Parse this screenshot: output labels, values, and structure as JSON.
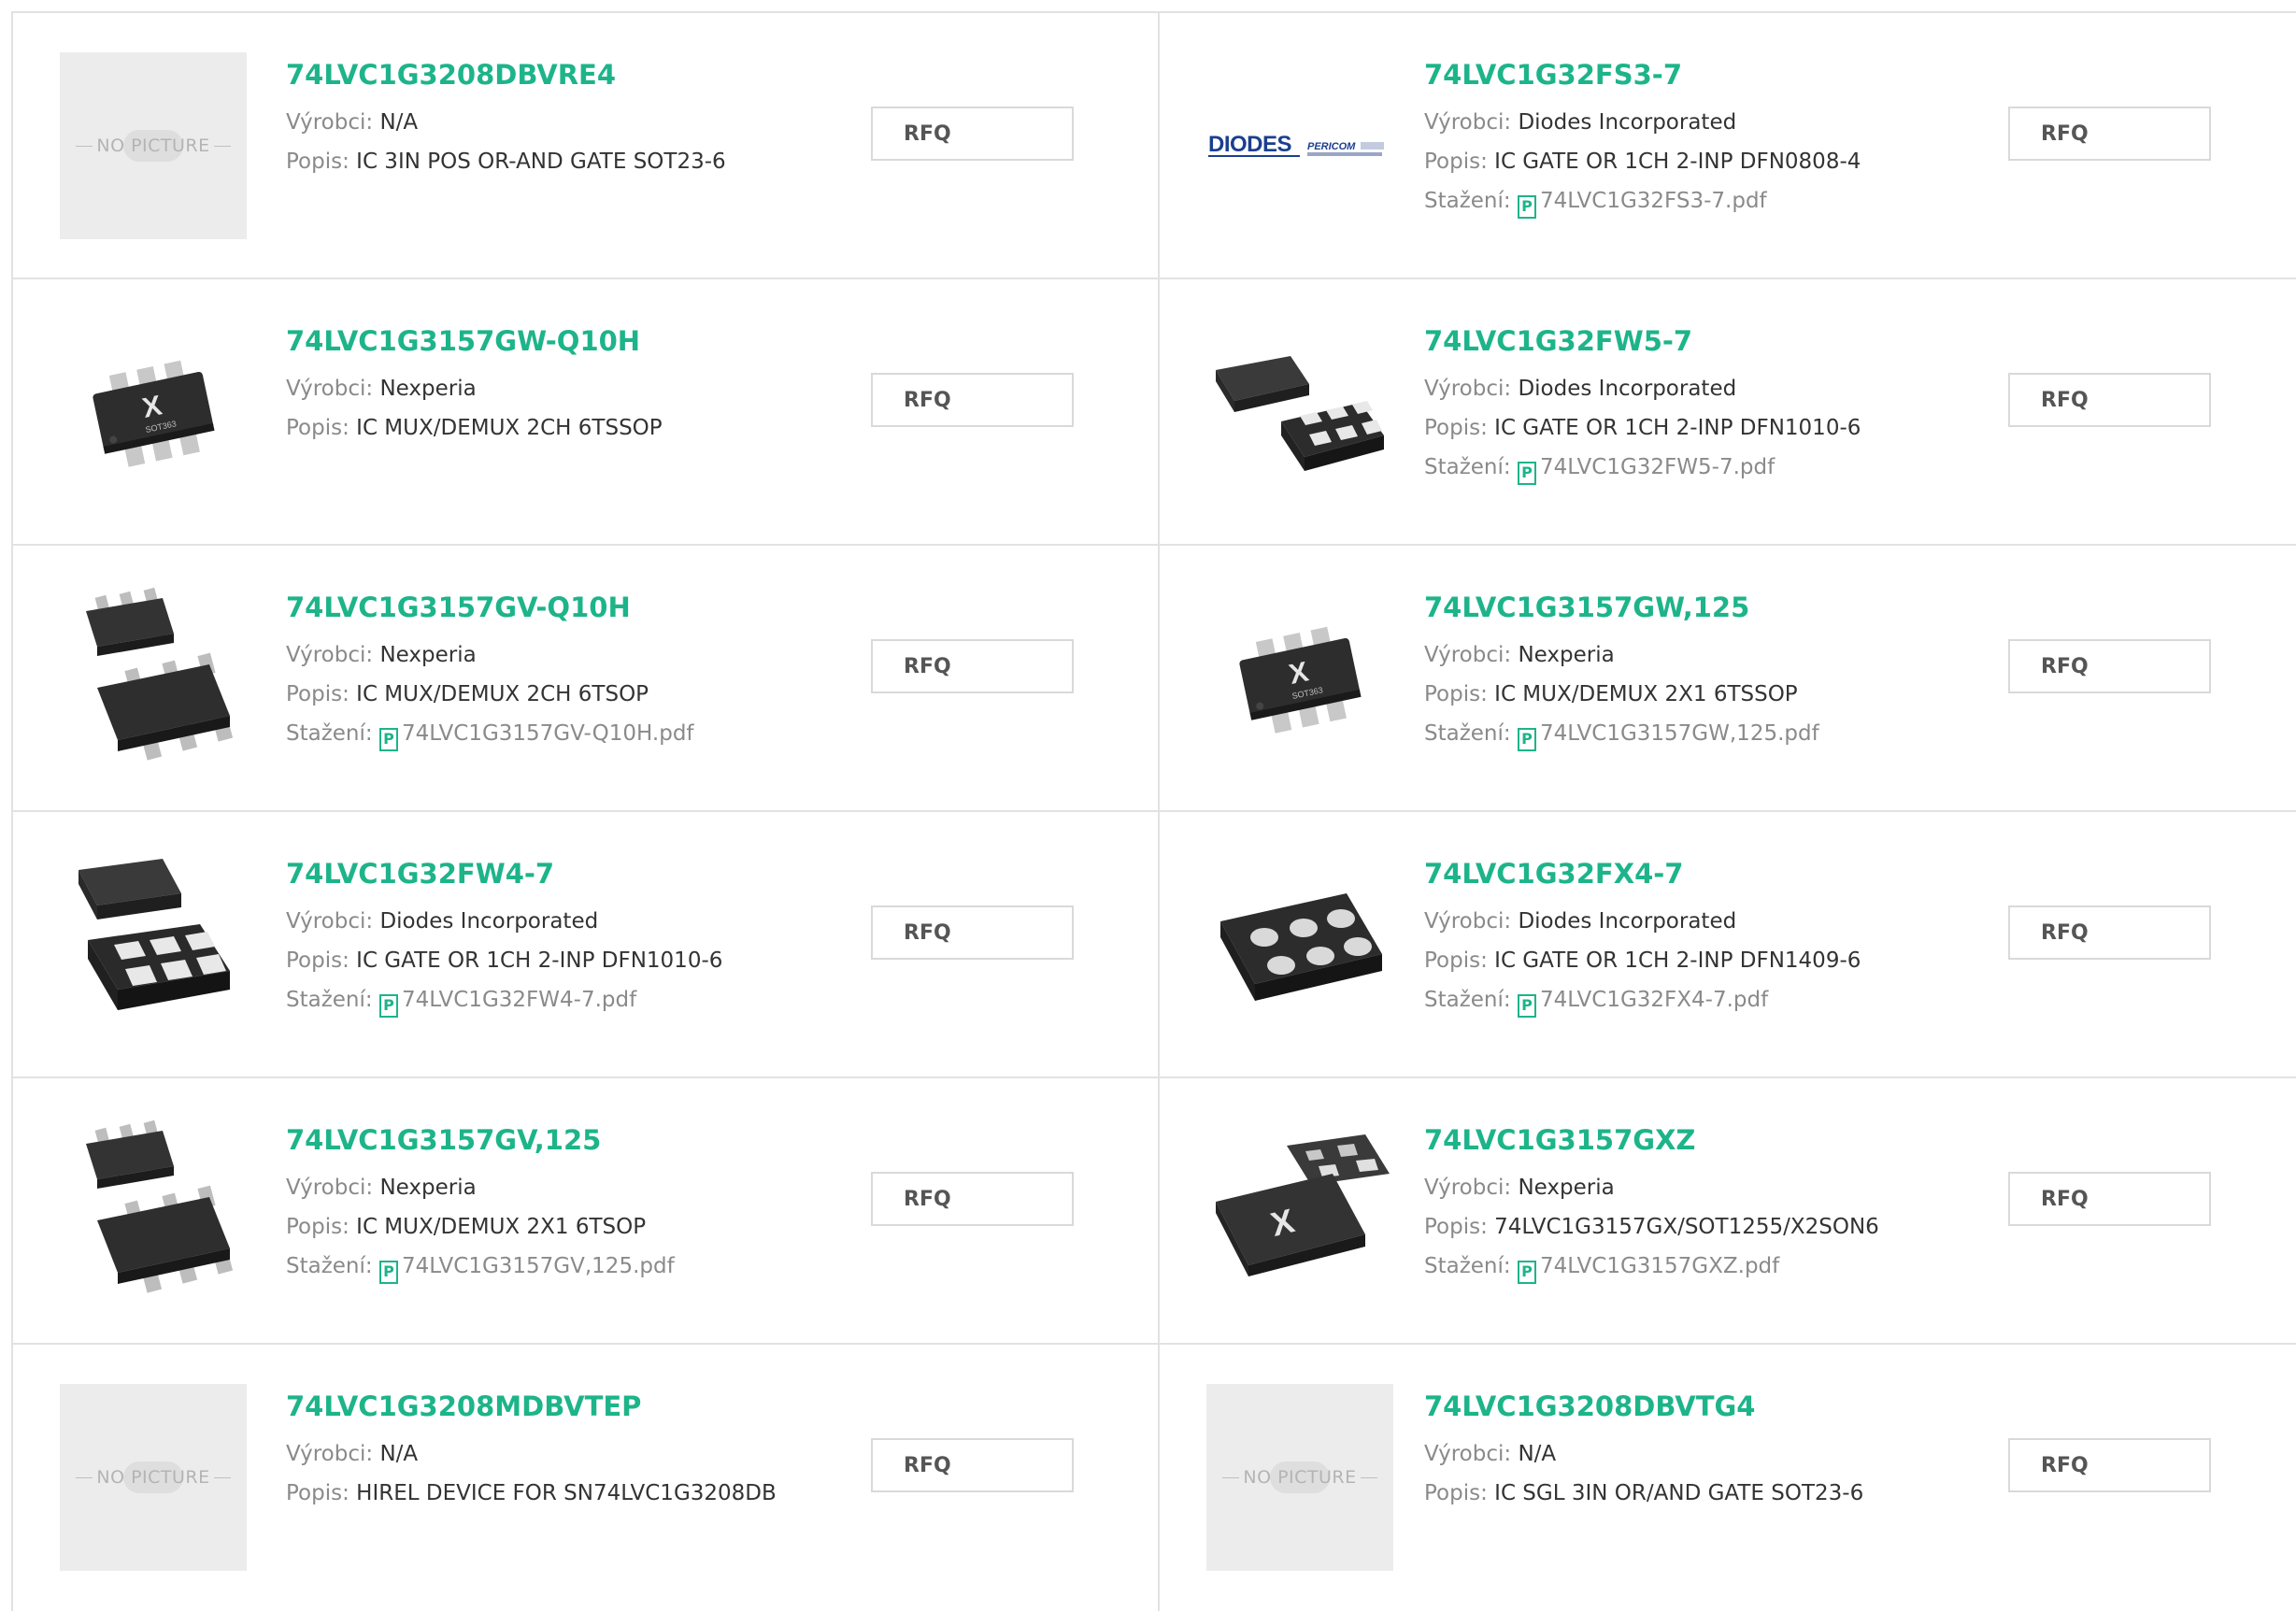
{
  "labels": {
    "manufacturer": "Výrobci:",
    "description": "Popis:",
    "download": "Stažení:",
    "rfq": "RFQ",
    "no_picture": "NO PICTURE"
  },
  "products": [
    {
      "part": "74LVC1G3208DBVRE4",
      "manufacturer": "N/A",
      "description": "IC 3IN POS OR-AND GATE SOT23-6",
      "download": "",
      "image": "no-picture"
    },
    {
      "part": "74LVC1G32FS3-7",
      "manufacturer": "Diodes Incorporated",
      "description": "IC GATE OR 1CH 2-INP DFN0808-4",
      "download": "74LVC1G32FS3-7.pdf",
      "image": "diodes-logo"
    },
    {
      "part": "74LVC1G3157GW-Q10H",
      "manufacturer": "Nexperia",
      "description": "IC MUX/DEMUX 2CH 6TSSOP",
      "download": "",
      "image": "sot363-chip"
    },
    {
      "part": "74LVC1G32FW5-7",
      "manufacturer": "Diodes Incorporated",
      "description": "IC GATE OR 1CH 2-INP DFN1010-6",
      "download": "74LVC1G32FW5-7.pdf",
      "image": "dfn-chip"
    },
    {
      "part": "74LVC1G3157GV-Q10H",
      "manufacturer": "Nexperia",
      "description": "IC MUX/DEMUX 2CH 6TSOP",
      "download": "74LVC1G3157GV-Q10H.pdf",
      "image": "tsop-chips"
    },
    {
      "part": "74LVC1G3157GW,125",
      "manufacturer": "Nexperia",
      "description": "IC MUX/DEMUX 2X1 6TSSOP",
      "download": "74LVC1G3157GW,125.pdf",
      "image": "sot363-chip"
    },
    {
      "part": "74LVC1G32FW4-7",
      "manufacturer": "Diodes Incorporated",
      "description": "IC GATE OR 1CH 2-INP DFN1010-6",
      "download": "74LVC1G32FW4-7.pdf",
      "image": "dfn-chip-large"
    },
    {
      "part": "74LVC1G32FX4-7",
      "manufacturer": "Diodes Incorporated",
      "description": "IC GATE OR 1CH 2-INP DFN1409-6",
      "download": "74LVC1G32FX4-7.pdf",
      "image": "dfn1409-chip"
    },
    {
      "part": "74LVC1G3157GV,125",
      "manufacturer": "Nexperia",
      "description": "IC MUX/DEMUX 2X1 6TSOP",
      "download": "74LVC1G3157GV,125.pdf",
      "image": "tsop-chips"
    },
    {
      "part": "74LVC1G3157GXZ",
      "manufacturer": "Nexperia",
      "description": "74LVC1G3157GX/SOT1255/X2SON6",
      "download": "74LVC1G3157GXZ.pdf",
      "image": "x2son-chip"
    },
    {
      "part": "74LVC1G3208MDBVTEP",
      "manufacturer": "N/A",
      "description": "HIREL DEVICE FOR SN74LVC1G3208DB",
      "download": "",
      "image": "no-picture"
    },
    {
      "part": "74LVC1G3208DBVTG4",
      "manufacturer": "N/A",
      "description": "IC SGL 3IN OR/AND GATE SOT23-6",
      "download": "",
      "image": "no-picture"
    }
  ],
  "colors": {
    "accent": "#1db48a",
    "border": "#e2e2e2",
    "label": "#8a8a8a",
    "text": "#333333"
  }
}
